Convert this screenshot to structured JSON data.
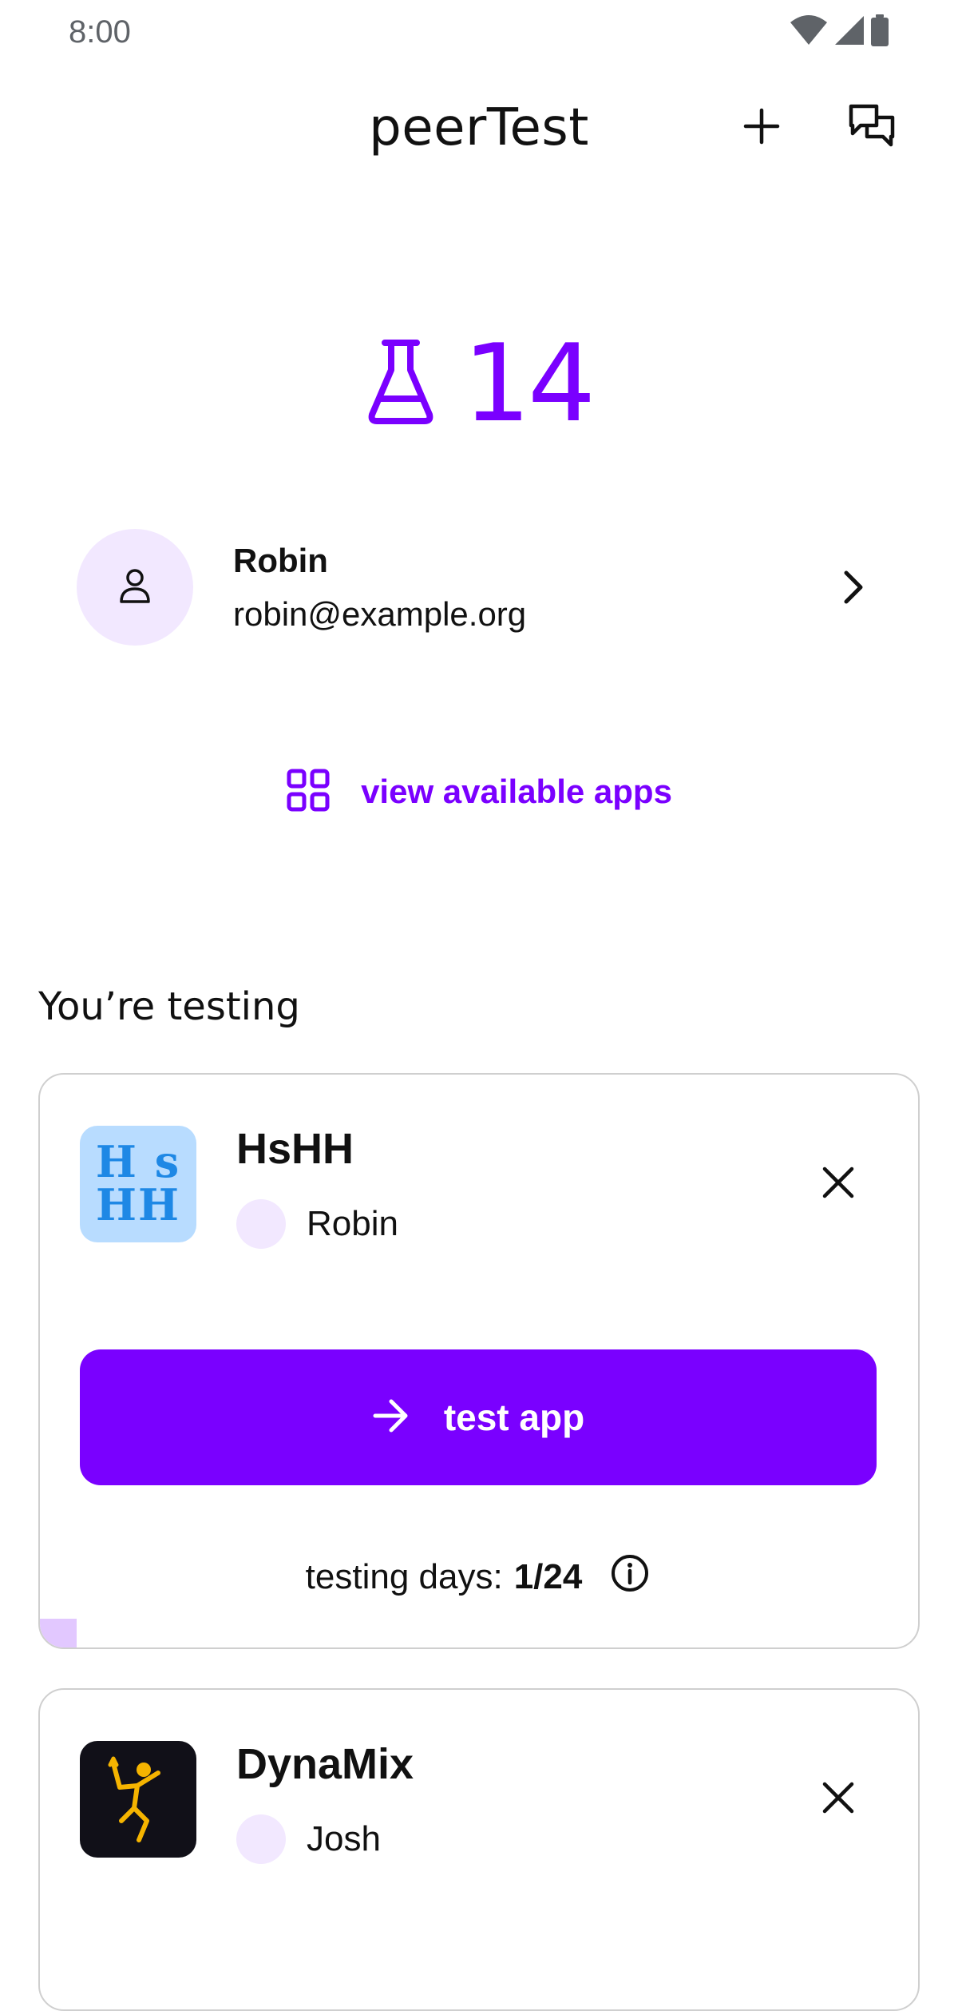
{
  "status_bar": {
    "time": "8:00",
    "icons": [
      "wifi-icon",
      "signal-icon",
      "battery-icon"
    ]
  },
  "header": {
    "title": "peerTest",
    "add_icon": "plus-icon",
    "messages_icon": "chat-icon"
  },
  "credits": {
    "icon": "flask-icon",
    "value": "14"
  },
  "profile": {
    "name": "Robin",
    "email": "robin@example.org",
    "avatar_icon": "person-icon",
    "chevron_icon": "chevron-right-icon"
  },
  "view_apps": {
    "icon": "grid-icon",
    "label": "view available apps"
  },
  "section": {
    "title": "You’re testing"
  },
  "apps": [
    {
      "name": "HsHH",
      "icon_text_top": "H s",
      "icon_text_bottom": "HH",
      "owner": "Robin",
      "button_label": "test app",
      "days_label": "testing days:",
      "days_value": "1/24",
      "progress": 0.0417
    },
    {
      "name": "DynaMix",
      "owner": "Josh"
    }
  ],
  "colors": {
    "accent": "#7a00ff",
    "accent_light": "#f2e8ff",
    "progress_fill": "#e2c8ff",
    "card_border": "#cfcfcf"
  }
}
